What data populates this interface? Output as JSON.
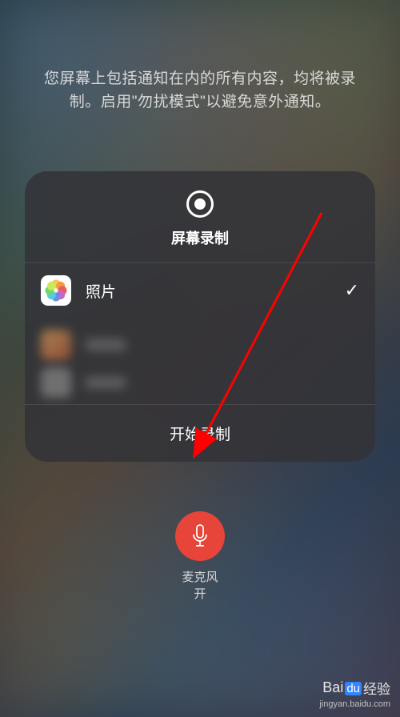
{
  "info_text": "您屏幕上包括通知在内的所有内容，均将被录制。启用\"勿扰模式\"以避免意外通知。",
  "panel": {
    "title": "屏幕录制",
    "options": [
      {
        "label": "照片",
        "selected": true,
        "icon": "photos"
      }
    ],
    "start_label": "开始录制"
  },
  "microphone": {
    "label_line1": "麦克风",
    "label_line2": "开",
    "state": "on"
  },
  "watermark": {
    "brand_prefix": "Bai",
    "brand_box": "du",
    "brand_suffix": "经验",
    "url": "jingyan.baidu.com"
  },
  "colors": {
    "mic_button": "#e7453a",
    "panel_bg": "rgba(50,50,55,0.85)",
    "arrow": "#ff0000"
  }
}
